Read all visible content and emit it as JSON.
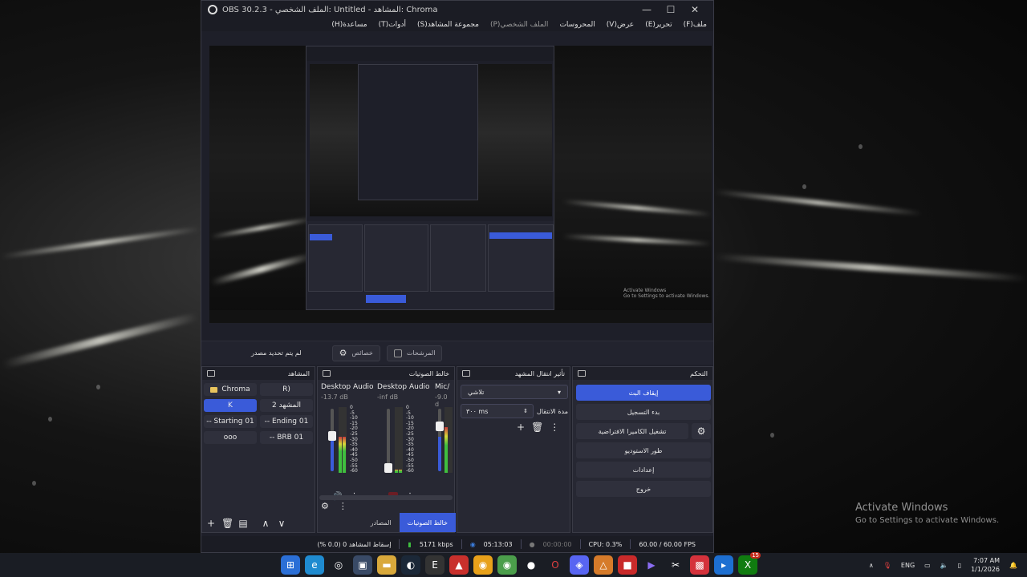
{
  "window": {
    "title": "OBS 30.2.3 - الملف الشخصي: Untitled - المشاهد: Chroma",
    "controls": [
      "—",
      "☐",
      "✕"
    ]
  },
  "menu": [
    {
      "label": "ملف(F)"
    },
    {
      "label": "تحرير(E)"
    },
    {
      "label": "عرض(V)"
    },
    {
      "label": "المحروسات"
    },
    {
      "label": "الملف الشخصي(P)"
    },
    {
      "label": "مجموعة المشاهد(S)"
    },
    {
      "label": "أدوات(T)"
    },
    {
      "label": "مساعدة(H)"
    }
  ],
  "preview": {
    "activate_line1": "Activate Windows",
    "activate_line2": "Go to Settings to activate Windows."
  },
  "source_bar": {
    "no_source": "لم يتم تحديد مصدر",
    "properties": "خصائص",
    "filters": "المرشحات"
  },
  "scenes": {
    "title": "المشاهد",
    "items": [
      {
        "label": "Chroma",
        "folder": true
      },
      {
        "label": "R)"
      },
      {
        "label": "K",
        "active": true
      },
      {
        "label": "المشهد 2"
      },
      {
        "label": "-- Starting 01"
      },
      {
        "label": "-- Ending 01"
      },
      {
        "label": "ooo"
      },
      {
        "label": "-- BRB 01"
      }
    ],
    "foot": [
      "+",
      "🗑",
      "▤",
      "∧",
      "∨"
    ]
  },
  "mixer": {
    "title": "خالط الصوتيات",
    "channels": [
      {
        "name": "Desktop Audio",
        "db": "-13.7 dB",
        "level": 0.55
      },
      {
        "name": "Desktop Audio 2",
        "db": "-inf dB",
        "level": 0.05
      },
      {
        "name": "Mic/",
        "db": "-9.0 d",
        "level": 0.7
      }
    ],
    "scale": [
      "0",
      "-5",
      "-10",
      "-15",
      "-20",
      "-25",
      "-30",
      "-35",
      "-40",
      "-45",
      "-50",
      "-55",
      "-60"
    ],
    "tabs": [
      "خالط الصوتيات",
      "المصادر"
    ]
  },
  "transitions": {
    "title": "تأثير انتقال المشهد",
    "selected": "تلاشي",
    "duration_label": "مدة الانتقال",
    "duration": "٣٠٠ ms"
  },
  "controls": {
    "title": "التحكم",
    "buttons": [
      {
        "label": "إيقاف البث",
        "primary": true
      },
      {
        "label": "بدء التسجيل"
      },
      {
        "label": "تشغيل الكاميرا الافتراضية"
      },
      {
        "label": "طور الاستوديو"
      },
      {
        "label": "إعدادات"
      },
      {
        "label": "خروج"
      }
    ]
  },
  "status": {
    "dropped": "إسقاط المشاهد 0 (0.0 %)",
    "bitrate": "5171 kbps",
    "stream_time": "05:13:03",
    "rec_time": "00:00:00",
    "cpu": "CPU: 0.3%",
    "fps": "60.00 / 60.00 FPS"
  },
  "desktop": {
    "activate_line1": "Activate Windows",
    "activate_line2": "Go to Settings to activate Windows."
  },
  "taskbar": {
    "lang": "ENG",
    "time": "7:07 AM",
    "date": "1/1/2026",
    "badge": "15"
  },
  "colors": {
    "accent": "#3a5bd9",
    "panel": "#272833",
    "window": "#1e1f29"
  }
}
